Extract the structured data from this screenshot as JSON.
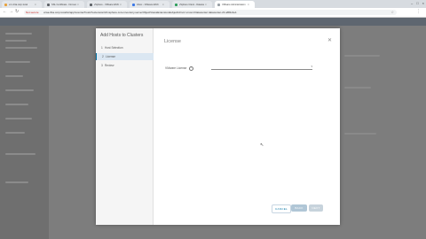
{
  "browser": {
    "tabs": [
      {
        "label": "vc-l-01a.corp.local",
        "icon_color": "#e8a13b",
        "active": false
      },
      {
        "label": "SSL Certificate - Not secure",
        "icon_color": "#5f6368",
        "active": false
      },
      {
        "label": "vSphere - VMware ESXi",
        "icon_color": "#5f6368",
        "active": false
      },
      {
        "label": "Inbox - VMware ESXi",
        "icon_color": "#3b78e7",
        "active": false
      },
      {
        "label": "vSphere Client - Datacenter",
        "icon_color": "#2e9e5b",
        "active": false
      },
      {
        "label": "VMware Administration",
        "icon_color": "#9aa0a6",
        "active": true
      }
    ],
    "security_label": "Not secure",
    "url": "vcsa-01a.corp.local/ui/app/vcenter/hosts?extensionId=vsphere.core.inventory.serverObjectViewsExtension&objectId=urn:vmomi:Datacenter:datacenter-21:a8f2c4e1"
  },
  "modal": {
    "title": "Add Hosts to Clusters",
    "steps": [
      {
        "number": "1",
        "label": "Host Selection",
        "active": false
      },
      {
        "number": "2",
        "label": "License",
        "active": true
      },
      {
        "number": "3",
        "label": "Review",
        "active": false
      }
    ],
    "content_title": "License",
    "field_label": "VMware License",
    "info_icon_glyph": "i",
    "buttons": {
      "cancel": "CANCEL",
      "back": "BACK",
      "next": "NEXT"
    }
  },
  "colors": {
    "accent": "#0072a3",
    "step_active_bg": "#dbe7f2"
  }
}
